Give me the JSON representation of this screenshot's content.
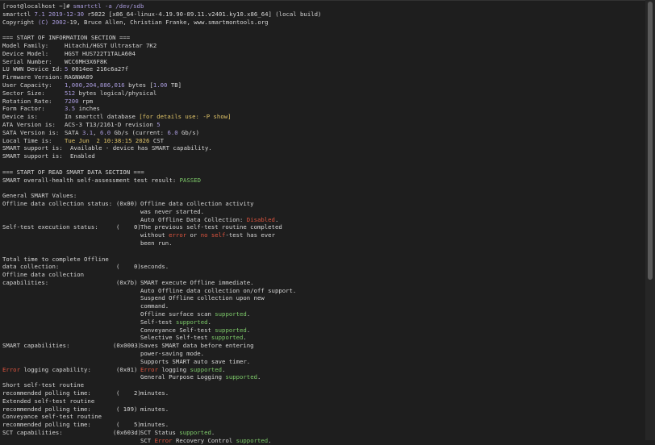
{
  "prompt": {
    "user_host": "[root@localhost ~]#",
    "command": "smartctl -a /dev/sdb"
  },
  "header": {
    "line1_prefix": "smartctl ",
    "version": "7.1",
    "date": " 2019-12-30 ",
    "line1_suffix": "r5022 [x86_64-linux-4.19.90-89.11.v2401.ky10.x86_64] (local build)",
    "copyright_prefix": "Copyright ",
    "copyright_c": "(C)",
    "copyright_years": " 2002",
    "copyright_suffix": "-19, Bruce Allen, Christian Franke, www.smartmontools.org"
  },
  "info": {
    "section_title": "=== START OF INFORMATION SECTION ===",
    "model_family_label": "Model Family:",
    "model_family": "Hitachi/HGST Ultrastar 7K2",
    "device_model_label": "Device Model:",
    "device_model": "HGST HUS722T1TALA604",
    "serial_label": "Serial Number:",
    "serial": "WCC6MH3X6F8K",
    "lu_wwn_label": "LU WWN Device Id:",
    "lu_wwn_first": "5",
    "lu_wwn_rest": " 0014ee 216c6a27f",
    "firmware_label": "Firmware Version:",
    "firmware": "RAGNWA09",
    "capacity_label": "User Capacity:",
    "capacity_bytes": "1,000,204,886,016",
    "capacity_mid": " bytes [",
    "capacity_tb": "1.00",
    "capacity_unit": " TB]",
    "sector_label": "Sector Size:",
    "sector_num": "512",
    "sector_rest": " bytes logical/physical",
    "rotation_label": "Rotation Rate:",
    "rotation_num": "7200",
    "rotation_rest": " rpm",
    "form_label": "Form Factor:",
    "form_num": "3.5",
    "form_rest": " inches",
    "device_is_label": "Device is:",
    "device_is_a": "In smartctl database ",
    "device_is_b": "[for details use: ",
    "device_is_c": "-P",
    "device_is_d": " show]",
    "ata_label": "ATA Version is:",
    "ata_text": "ACS-3 T13/2161-D revision ",
    "ata_rev": "5",
    "sata_label": "SATA Version is:",
    "sata_a": "SATA ",
    "sata_v": "3.1",
    "sata_b": ", ",
    "sata_speed1": "6.0",
    "sata_c": " Gb/s (current: ",
    "sata_speed2": "6.0",
    "sata_d": " Gb/s)",
    "local_time_label": "Local Time is:",
    "local_time_a": "Tue Jun  2 10:38:15 2026",
    "local_time_b": " CST",
    "smart_support_label_1": "SMART support is:",
    "smart_support_1": "Available - device has SMART capability.",
    "smart_support_label_2": "SMART support is:",
    "smart_support_2": "Enabled"
  },
  "read": {
    "section_title": "=== START OF READ SMART DATA SECTION ===",
    "health_label": "SMART overall-health self-assessment test result: ",
    "health_value": "PASSED",
    "general_title": "General SMART Values:",
    "odc_label": "Offline data collection status:",
    "odc_hex": "(0x00)",
    "odc_desc1": "Offline data collection activity",
    "odc_desc2": "was never started.",
    "odc_desc3_a": "Auto Offline Data Collection: ",
    "odc_desc3_b": "Disabled",
    "odc_desc3_c": ".",
    "selftest_label": "Self-test execution status:",
    "selftest_hex": "(    0)",
    "selftest_desc1": "The previous self-test routine completed",
    "selftest_desc2_a": "without ",
    "selftest_desc2_b": "error",
    "selftest_desc2_c": " or ",
    "selftest_desc2_d": "no self",
    "selftest_desc2_e": "-test has ever",
    "selftest_desc3": "been run.",
    "total_time_1": "Total time to complete Offline",
    "total_time_2": "data collection:",
    "total_time_hex": "(    0)",
    "total_time_desc": "seconds.",
    "odc_cap_1": "Offline data collection",
    "odc_cap_2": "capabilities:",
    "odc_cap_hex": "(0x7b)",
    "odc_cap_desc1": "SMART execute Offline immediate.",
    "odc_cap_desc2": "Auto Offline data collection on/off support.",
    "odc_cap_desc3": "Suspend Offline collection upon new",
    "odc_cap_desc4": "command.",
    "odc_cap_desc5_a": "Offline surface scan ",
    "odc_cap_desc5_b": "supported",
    "odc_cap_desc6_a": "Self-test ",
    "odc_cap_desc6_b": "supported",
    "odc_cap_desc7_a": "Conveyance Self-test ",
    "odc_cap_desc7_b": "supported",
    "odc_cap_desc8_a": "Selective Self-test ",
    "odc_cap_desc8_b": "supported",
    "dot": ".",
    "smart_cap_label": "SMART capabilities:",
    "smart_cap_hex": "(0x0003)",
    "smart_cap_desc1": "Saves SMART data before entering",
    "smart_cap_desc2": "power-saving mode.",
    "smart_cap_desc3": "Supports SMART auto save timer.",
    "err_log_label_a": "Error",
    "err_log_label_b": " logging capability:",
    "err_log_hex": "(0x01)",
    "err_log_desc1_a": "Error",
    "err_log_desc1_b": " logging ",
    "err_log_desc1_c": "supported",
    "err_log_desc2_a": "General Purpose Logging ",
    "err_log_desc2_b": "supported",
    "short_1": "Short self-test routine",
    "short_2": "recommended polling time:",
    "short_hex": "(    2)",
    "short_desc": "minutes.",
    "ext_1": "Extended self-test routine",
    "ext_2": "recommended polling time:",
    "ext_hex": "( 109)",
    "ext_desc": "minutes.",
    "conv_1": "Conveyance self-test routine",
    "conv_2": "recommended polling time:",
    "conv_hex": "(    5)",
    "conv_desc": "minutes.",
    "sct_label": "SCT capabilities:",
    "sct_hex": "(0x603d)",
    "sct_desc1_a": "SCT Status ",
    "sct_desc1_b": "supported",
    "sct_desc2_a": "SCT ",
    "sct_desc2_b": "Error",
    "sct_desc2_c": " Recovery Control ",
    "sct_desc2_d": "supported"
  }
}
